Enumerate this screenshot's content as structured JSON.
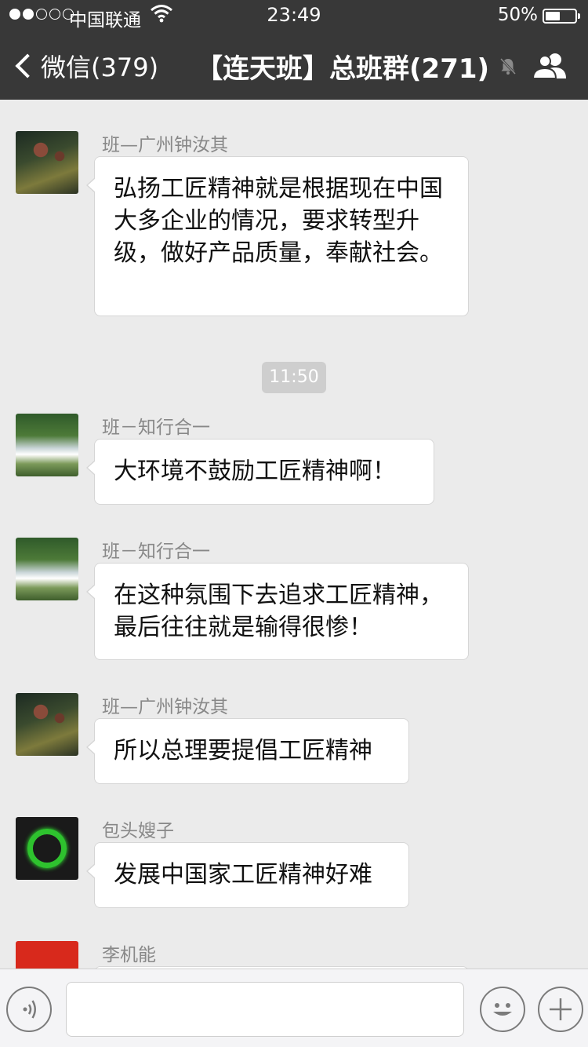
{
  "status_bar": {
    "carrier": "中国联通",
    "time": "23:49",
    "battery": "50%",
    "battery_level": 0.5,
    "signal_bars_filled": 2,
    "signal_bars_total": 5
  },
  "nav": {
    "back_label": "微信(379)",
    "title": "【连天班】总班群(271)",
    "icons": [
      "chevron-left-icon",
      "mute-bell-icon",
      "group-members-icon"
    ]
  },
  "messages": [
    {
      "sender": "班—广州钟汝其",
      "text": "弘扬工匠精神就是根据现在中国大多企业的情况，要求转型升级，做好产品质量，奉献社会。"
    },
    {
      "sender": "班－知行合一",
      "text": "大环境不鼓励工匠精神啊！"
    },
    {
      "sender": "班－知行合一",
      "text": "在这种氛围下去追求工匠精神，最后往往就是输得很惨！"
    },
    {
      "sender": "班—广州钟汝其",
      "text": "所以总理要提倡工匠精神"
    },
    {
      "sender": "包头嫂子",
      "text": "发展中国家工匠精神好难"
    },
    {
      "sender": "李机能",
      "text": ""
    }
  ],
  "timestamp": "11:50",
  "colors": {
    "topbar": "#383838",
    "background": "#ebebeb",
    "bubble": "#ffffff",
    "sender": "#888888"
  },
  "input_bar": {
    "icons": [
      "voice-icon",
      "emoji-icon",
      "plus-icon"
    ]
  }
}
